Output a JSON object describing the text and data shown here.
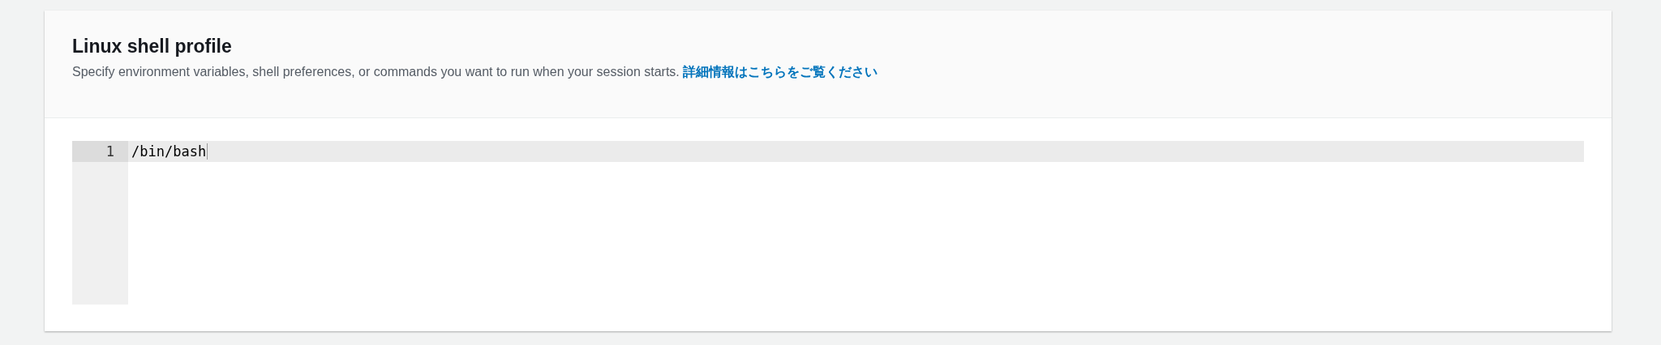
{
  "panel": {
    "title": "Linux shell profile",
    "description": "Specify environment variables, shell preferences, or commands you want to run when your session starts.",
    "link": "詳細情報はこちらをご覧ください"
  },
  "editor": {
    "lines": [
      {
        "number": "1",
        "text": "/bin/bash",
        "active": true
      }
    ]
  }
}
